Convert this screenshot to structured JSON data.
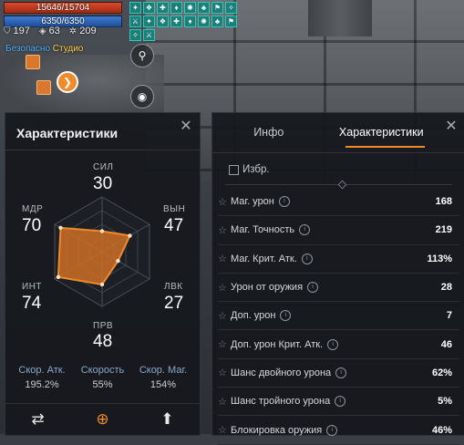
{
  "hud": {
    "hp": "15646/15704",
    "mp": "6350/6350",
    "stats": [
      {
        "icon": "shield-icon",
        "value": "197"
      },
      {
        "icon": "defense-icon",
        "value": "63"
      },
      {
        "icon": "gear-icon",
        "value": "209"
      }
    ],
    "studio_label": "Безопасно",
    "studio_label_highlight": "Студио",
    "buff_count": 18
  },
  "left_panel": {
    "title": "Характеристики",
    "stats": [
      {
        "key": "str",
        "label": "СИЛ",
        "value": "30"
      },
      {
        "key": "vit",
        "label": "ВЫН",
        "value": "47"
      },
      {
        "key": "dex",
        "label": "ЛВК",
        "value": "27"
      },
      {
        "key": "per",
        "label": "ПРВ",
        "value": "48"
      },
      {
        "key": "int",
        "label": "ИНТ",
        "value": "74"
      },
      {
        "key": "wis",
        "label": "МДР",
        "value": "70"
      }
    ],
    "speeds": [
      {
        "label": "Скор. Атк.",
        "value": "195.2%"
      },
      {
        "label": "Скорость",
        "value": "55%"
      },
      {
        "label": "Скор. Маг.",
        "value": "154%"
      }
    ],
    "radar_max": 80,
    "accent": "#f08a2a"
  },
  "right_panel": {
    "tabs": [
      {
        "label": "Инфо",
        "active": false
      },
      {
        "label": "Характеристики",
        "active": true
      }
    ],
    "favorites_label": "Избр.",
    "rows": [
      {
        "name": "Маг. урон",
        "value": "168"
      },
      {
        "name": "Маг. Точность",
        "value": "219"
      },
      {
        "name": "Маг. Крит. Атк.",
        "value": "113%"
      },
      {
        "name": "Урон от оружия",
        "value": "28"
      },
      {
        "name": "Доп. урон",
        "value": "7"
      },
      {
        "name": "Доп. урон Крит. Атк.",
        "value": "46"
      },
      {
        "name": "Шанс двойного урона",
        "value": "62%"
      },
      {
        "name": "Шанс тройного урона",
        "value": "5%"
      },
      {
        "name": "Блокировка оружия",
        "value": "46%"
      }
    ]
  }
}
